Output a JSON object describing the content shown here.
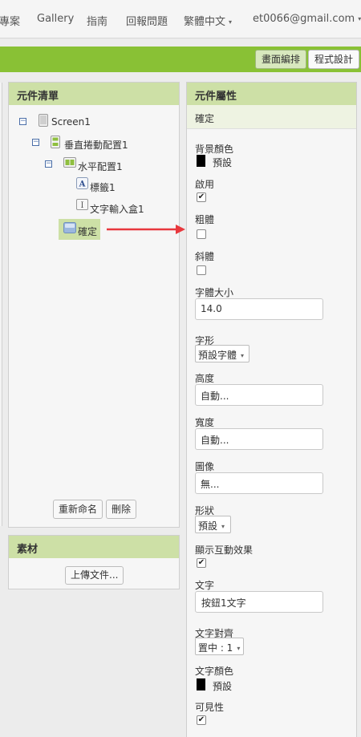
{
  "topnav": {
    "items": [
      "專案",
      "Gallery",
      "指南",
      "回報問題"
    ],
    "language": "繁體中文",
    "account": "et0066@gmail.com"
  },
  "toolbar": {
    "designer_label": "畫面編排",
    "blocks_label": "程式設計"
  },
  "components": {
    "title": "元件清單",
    "tree": [
      "Screen1",
      "垂直捲動配置1",
      "水平配置1",
      "標籤1",
      "文字輸入盒1",
      "確定"
    ],
    "rename_label": "重新命名",
    "delete_label": "刪除"
  },
  "media": {
    "title": "素材",
    "upload_label": "上傳文件..."
  },
  "properties": {
    "title": "元件屬性",
    "component_name": "確定",
    "background_color_label": "背景顏色",
    "background_color_value": "預設",
    "enabled_label": "啟用",
    "enabled_checked": true,
    "bold_label": "粗體",
    "bold_checked": false,
    "italic_label": "斜體",
    "italic_checked": false,
    "font_size_label": "字體大小",
    "font_size_value": "14.0",
    "font_family_label": "字形",
    "font_family_value": "預設字體",
    "height_label": "高度",
    "height_value": "自動...",
    "width_label": "寬度",
    "width_value": "自動...",
    "image_label": "圖像",
    "image_value": "無...",
    "shape_label": "形狀",
    "shape_value": "預設",
    "show_feedback_label": "顯示互動效果",
    "show_feedback_checked": true,
    "text_label": "文字",
    "text_value": "按鈕1文字",
    "text_alignment_label": "文字對齊",
    "text_alignment_value": "置中 : 1",
    "text_color_label": "文字顏色",
    "text_color_value": "預設",
    "visible_label": "可見性",
    "visible_checked": true
  },
  "colors": {
    "toolbar_green": "#89c135",
    "panel_header": "#cde0a6",
    "annotation_arrow": "#e8383d"
  },
  "icons": {
    "checkmark": "✔",
    "dropdown": "▾"
  }
}
